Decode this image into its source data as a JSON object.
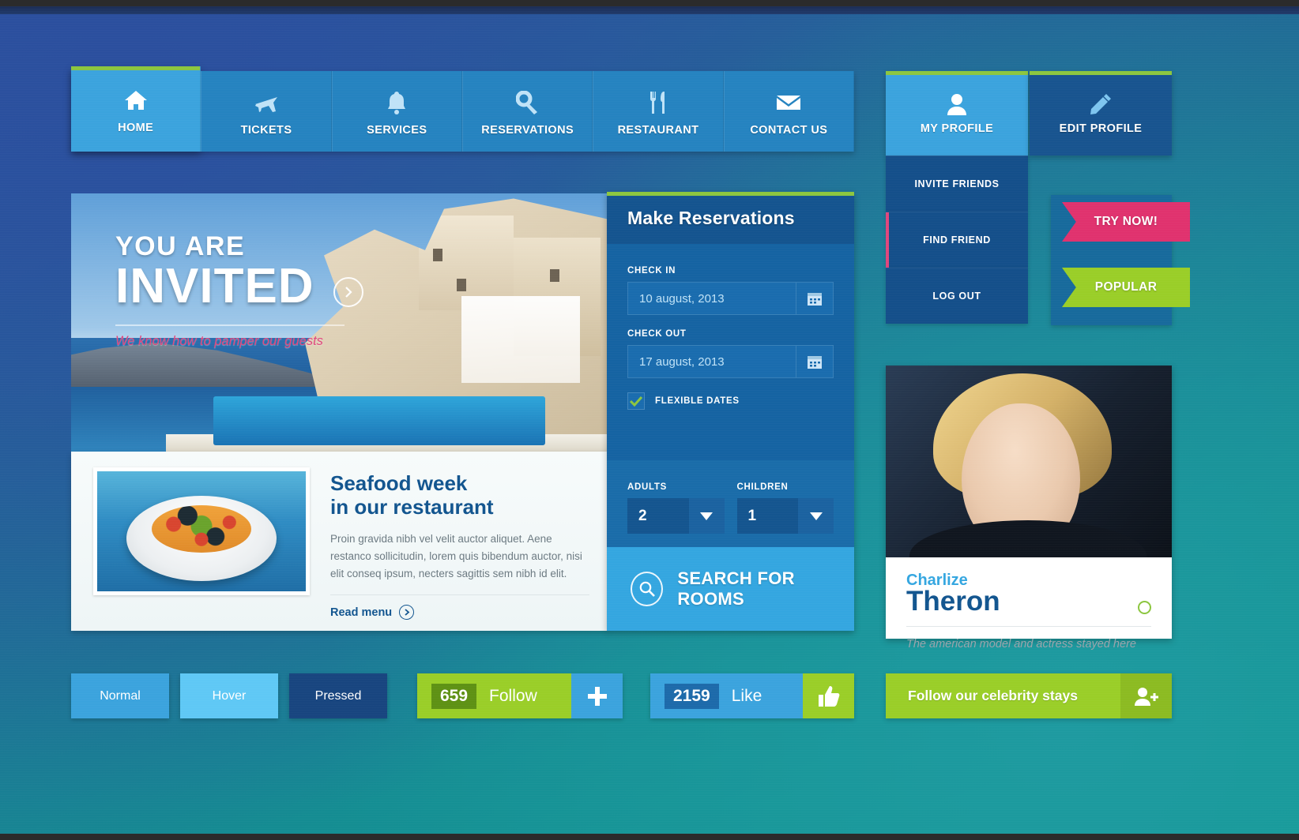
{
  "nav": {
    "items": [
      {
        "label": "HOME",
        "icon": "home-icon",
        "active": true
      },
      {
        "label": "TICKETS",
        "icon": "airplane-icon",
        "active": false
      },
      {
        "label": "SERVICES",
        "icon": "bell-icon",
        "active": false
      },
      {
        "label": "RESERVATIONS",
        "icon": "key-icon",
        "active": false
      },
      {
        "label": "RESTAURANT",
        "icon": "cutlery-icon",
        "active": false
      },
      {
        "label": "CONTACT US",
        "icon": "envelope-icon",
        "active": false
      }
    ]
  },
  "hero": {
    "kicker": "YOU ARE",
    "title": "INVITED",
    "tagline": "We know how to pamper our guests",
    "arrow_icon": "chevron-right-circle-icon"
  },
  "seafood": {
    "title": "Seafood week\nin our restaurant",
    "body": "Proin gravida nibh vel velit auctor aliquet. Aene restanco sollicitudin, lorem quis bibendum auctor, nisi elit conseq ipsum, necters sagittis sem nibh id elit.",
    "read_menu": "Read menu",
    "read_menu_icon": "chevron-right-circle-icon",
    "photo_alt": "seafood-plate-photo"
  },
  "reservations": {
    "title": "Make Reservations",
    "check_in_label": "CHECK IN",
    "check_in_value": "10 august, 2013",
    "check_out_label": "CHECK OUT",
    "check_out_value": "17 august, 2013",
    "calendar_icon": "calendar-icon",
    "flexible_label": "FLEXIBLE DATES",
    "flexible_checked": true,
    "adults_label": "ADULTS",
    "adults_value": "2",
    "children_label": "CHILDREN",
    "children_value": "1",
    "caret_icon": "caret-down-icon",
    "search_label": "SEARCH FOR ROOMS",
    "search_icon": "magnifier-icon",
    "accent_top": "#8cc63f"
  },
  "profile": {
    "my_profile": "MY PROFILE",
    "my_profile_icon": "user-icon",
    "edit_profile": "EDIT PROFILE",
    "edit_profile_icon": "pencil-icon",
    "menu": [
      {
        "label": "INVITE FRIENDS",
        "highlight": false
      },
      {
        "label": "FIND FRIEND",
        "highlight": true
      },
      {
        "label": "LOG OUT",
        "highlight": false
      }
    ]
  },
  "ribbons": [
    {
      "label": "TRY NOW!",
      "color": "#e0326e"
    },
    {
      "label": "POPULAR",
      "color": "#9ace28"
    }
  ],
  "celebrity": {
    "first_name": "Charlize",
    "last_name": "Theron",
    "subtitle": "The american model and actress stayed here",
    "status_icon": "status-ring-icon",
    "follow_label": "Follow our celebrity stays",
    "follow_icon": "add-user-icon",
    "photo_alt": "celebrity-portrait-photo"
  },
  "state_buttons": [
    {
      "label": "Normal",
      "color": "#3ba3dd"
    },
    {
      "label": "Hover",
      "color": "#5fc8f5"
    },
    {
      "label": "Pressed",
      "color": "#18457f"
    }
  ],
  "social": {
    "follow": {
      "count": "659",
      "word": "Follow",
      "icon": "plus-icon"
    },
    "like": {
      "count": "2159",
      "word": "Like",
      "icon": "thumbs-up-icon"
    }
  },
  "colors": {
    "green": "#8cc63f",
    "pink": "#e0326e",
    "blue_light": "#3ba3dd",
    "blue_dark": "#12558f"
  }
}
